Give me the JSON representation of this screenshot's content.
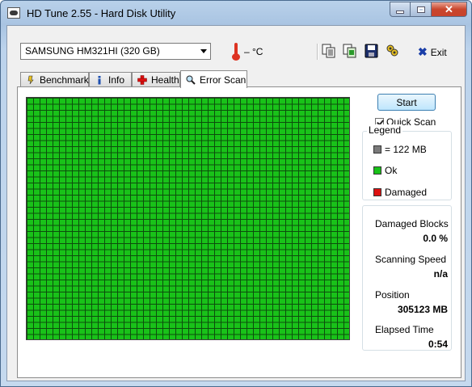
{
  "window": {
    "title": "HD Tune 2.55 - Hard Disk Utility"
  },
  "toolbar": {
    "drive": "SAMSUNG HM321HI (320 GB)",
    "temperature": "– °C",
    "exit_label": "Exit",
    "icons": [
      "copy-text-icon",
      "copy-screenshot-icon",
      "save-icon",
      "options-icon"
    ]
  },
  "tabs": [
    {
      "label": "Benchmark",
      "icon": "benchmark-icon"
    },
    {
      "label": "Info",
      "icon": "info-icon"
    },
    {
      "label": "Health",
      "icon": "health-icon"
    },
    {
      "label": "Error Scan",
      "icon": "magnifier-icon",
      "active": true
    }
  ],
  "scan": {
    "start_label": "Start",
    "quick_scan_label": "Quick Scan",
    "quick_scan_checked": true,
    "block_color": "#19c219"
  },
  "legend": {
    "title": "Legend",
    "block_size": "= 122 MB",
    "ok_label": "Ok",
    "damaged_label": "Damaged",
    "colors": {
      "block": "#7a7a7a",
      "ok": "#19c219",
      "damaged": "#d11"
    }
  },
  "stats": {
    "damaged_blocks_label": "Damaged Blocks",
    "damaged_blocks_value": "0.0 %",
    "scanning_speed_label": "Scanning Speed",
    "scanning_speed_value": "n/a",
    "position_label": "Position",
    "position_value": "305123 MB",
    "elapsed_time_label": "Elapsed Time",
    "elapsed_time_value": "0:54"
  }
}
